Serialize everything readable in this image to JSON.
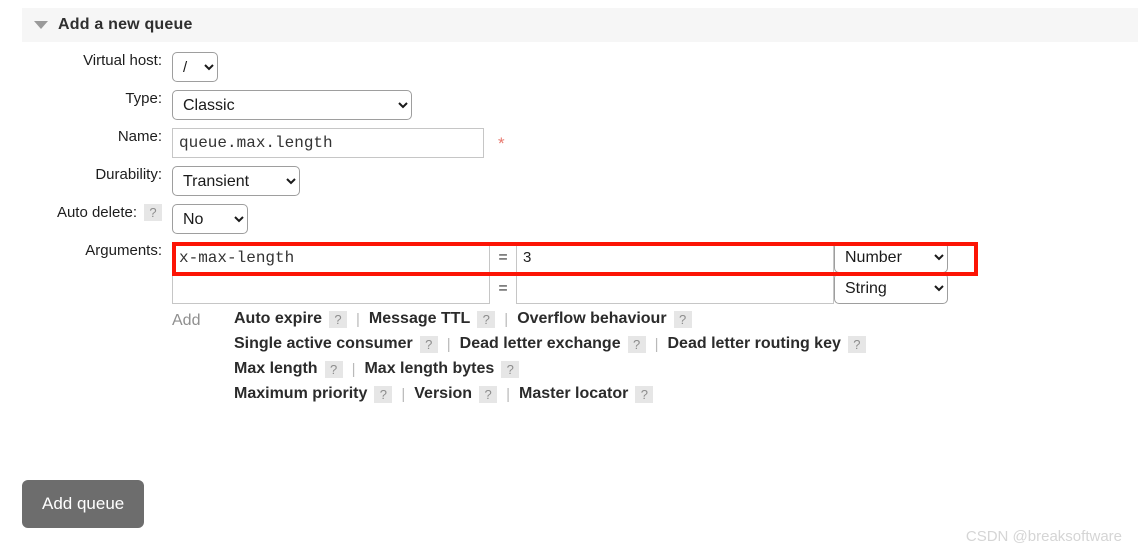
{
  "header": {
    "title": "Add a new queue",
    "collapse_icon": "triangle-down-icon"
  },
  "form": {
    "virtual_host": {
      "label": "Virtual host:",
      "value": "/"
    },
    "type": {
      "label": "Type:",
      "value": "Classic"
    },
    "name": {
      "label": "Name:",
      "value": "queue.max.length",
      "placeholder": "",
      "required_marker": "*"
    },
    "durability": {
      "label": "Durability:",
      "value": "Transient"
    },
    "auto_delete": {
      "label": "Auto delete:",
      "value": "No",
      "help": "?"
    },
    "arguments": {
      "label": "Arguments:",
      "equals": "=",
      "rows": [
        {
          "key": "x-max-length",
          "value": "3",
          "type": "Number"
        },
        {
          "key": "",
          "value": "",
          "type": "String"
        }
      ]
    }
  },
  "presets": {
    "add_label": "Add",
    "help": "?",
    "separator": "|",
    "rows": [
      [
        {
          "label": "Auto expire"
        },
        {
          "label": "Message TTL"
        },
        {
          "label": "Overflow behaviour"
        }
      ],
      [
        {
          "label": "Single active consumer"
        },
        {
          "label": "Dead letter exchange"
        },
        {
          "label": "Dead letter routing key"
        }
      ],
      [
        {
          "label": "Max length"
        },
        {
          "label": "Max length bytes"
        }
      ],
      [
        {
          "label": "Maximum priority"
        },
        {
          "label": "Version"
        },
        {
          "label": "Master locator"
        }
      ]
    ]
  },
  "submit": {
    "label": "Add queue"
  },
  "watermark": {
    "text": "CSDN @breaksoftware"
  },
  "colors": {
    "highlight": "#fc1405",
    "button": "#6d6d6d",
    "header_bg": "#f6f6f6",
    "required": "#e8796f"
  }
}
